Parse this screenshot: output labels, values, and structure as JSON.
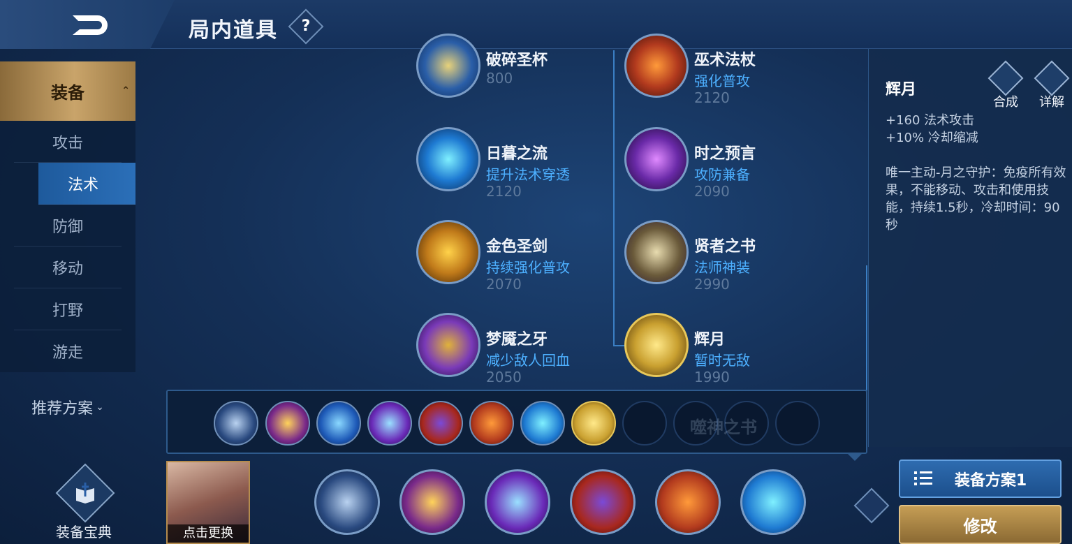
{
  "header": {
    "title": "局内道具",
    "help": "?"
  },
  "sidebar": {
    "main_category": "装备",
    "categories": [
      {
        "label": "攻击",
        "active": false
      },
      {
        "label": "法术",
        "active": true
      },
      {
        "label": "防御",
        "active": false
      },
      {
        "label": "移动",
        "active": false
      },
      {
        "label": "打野",
        "active": false
      },
      {
        "label": "游走",
        "active": false
      }
    ],
    "recommend_label": "推荐方案",
    "guide_label": "装备宝典"
  },
  "items": [
    {
      "name": "破碎圣杯",
      "desc": "",
      "price": "800",
      "icon": "broken-grail-icon",
      "color": "#2a5ea8"
    },
    {
      "name": "巫术法杖",
      "desc": "强化普攻",
      "price": "2120",
      "icon": "witch-staff-icon",
      "color": "#b23a1e"
    },
    {
      "name": "日暮之流",
      "desc": "提升法术穿透",
      "price": "2120",
      "icon": "dusk-flow-icon",
      "color": "#1e7ad2"
    },
    {
      "name": "时之预言",
      "desc": "攻防兼备",
      "price": "2090",
      "icon": "time-prophecy-icon",
      "color": "#6a2aa8"
    },
    {
      "name": "金色圣剑",
      "desc": "持续强化普攻",
      "price": "2070",
      "icon": "golden-sword-icon",
      "color": "#c07a1a"
    },
    {
      "name": "贤者之书",
      "desc": "法师神装",
      "price": "2990",
      "icon": "sage-book-icon",
      "color": "#6a5a3a"
    },
    {
      "name": "梦魇之牙",
      "desc": "减少敌人回血",
      "price": "2050",
      "icon": "nightmare-fang-icon",
      "color": "#7a3ab8"
    },
    {
      "name": "辉月",
      "desc": "暂时无敌",
      "price": "1990",
      "icon": "radiant-moon-icon",
      "color": "#c9a030"
    }
  ],
  "detail": {
    "name": "辉月",
    "compose_label": "合成",
    "explain_label": "详解",
    "stats": [
      "+160 法术攻击",
      "+10% 冷却缩减"
    ],
    "passive": "唯一主动-月之守护：免疫所有效果，不能移动、攻击和使用技能，持续1.5秒，冷却时间：90秒"
  },
  "strip": {
    "slots": [
      "boots-icon",
      "grail-icon",
      "trident-icon",
      "dragon-icon",
      "hat-icon",
      "staff-icon",
      "dusk-flow-icon",
      "radiant-moon-icon"
    ],
    "ghost_text": "噬神之书"
  },
  "bottom": {
    "portrait_label": "点击更换",
    "build": [
      "boots-icon",
      "grail-icon",
      "dragon-icon",
      "hat-icon",
      "staff-icon",
      "dusk-flow-icon"
    ],
    "plan_label": "装备方案1",
    "edit_label": "修改"
  }
}
